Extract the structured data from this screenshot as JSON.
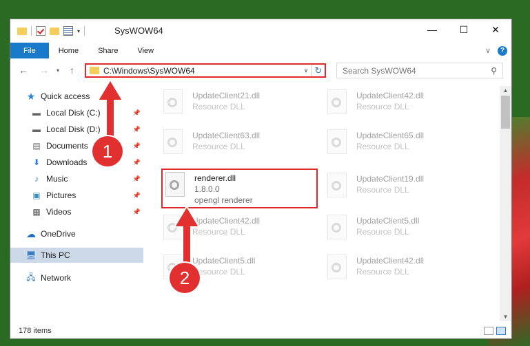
{
  "window": {
    "title": "SysWOW64"
  },
  "ribbon": {
    "tabs": [
      "File",
      "Home",
      "Share",
      "View"
    ]
  },
  "address": {
    "path": "C:\\Windows\\SysWOW64"
  },
  "search": {
    "placeholder": "Search SysWOW64"
  },
  "sidebar": {
    "quick_access": "Quick access",
    "items": [
      {
        "label": "Local Disk (C:)",
        "icon": "drive-icon",
        "pinned": true
      },
      {
        "label": "Local Disk (D:)",
        "icon": "drive-icon",
        "pinned": true
      },
      {
        "label": "Documents",
        "icon": "documents-icon",
        "pinned": true
      },
      {
        "label": "Downloads",
        "icon": "downloads-icon",
        "pinned": true
      },
      {
        "label": "Music",
        "icon": "music-icon",
        "pinned": true
      },
      {
        "label": "Pictures",
        "icon": "pictures-icon",
        "pinned": true
      },
      {
        "label": "Videos",
        "icon": "videos-icon",
        "pinned": true
      }
    ],
    "onedrive": "OneDrive",
    "this_pc": "This PC",
    "network": "Network"
  },
  "files": [
    {
      "name": "UpdateClient21.dll",
      "sub": "Resource DLL"
    },
    {
      "name": "UpdateClient42.dll",
      "sub": "Resource DLL"
    },
    {
      "name": "UpdateClient63.dll",
      "sub": "Resource DLL"
    },
    {
      "name": "UpdateClient65.dll",
      "sub": "Resource DLL"
    },
    {
      "name": "renderer.dll",
      "version": "1.8.0.0",
      "description": "opengl renderer"
    },
    {
      "name": "UpdateClient19.dll",
      "sub": "Resource DLL"
    },
    {
      "name": "UpdateClient42.dll",
      "sub": "Resource DLL"
    },
    {
      "name": "UpdateClient5.dll",
      "sub": "Resource DLL"
    },
    {
      "name": "UpdateClient5.dll",
      "sub": "Resource DLL"
    },
    {
      "name": "UpdateClient42.dll",
      "sub": "Resource DLL"
    }
  ],
  "status": {
    "item_count": "178 items"
  },
  "annotations": {
    "step1": "1",
    "step2": "2"
  },
  "colors": {
    "accent": "#1979ca",
    "highlight": "#e1282d",
    "badge": "#e23030"
  }
}
